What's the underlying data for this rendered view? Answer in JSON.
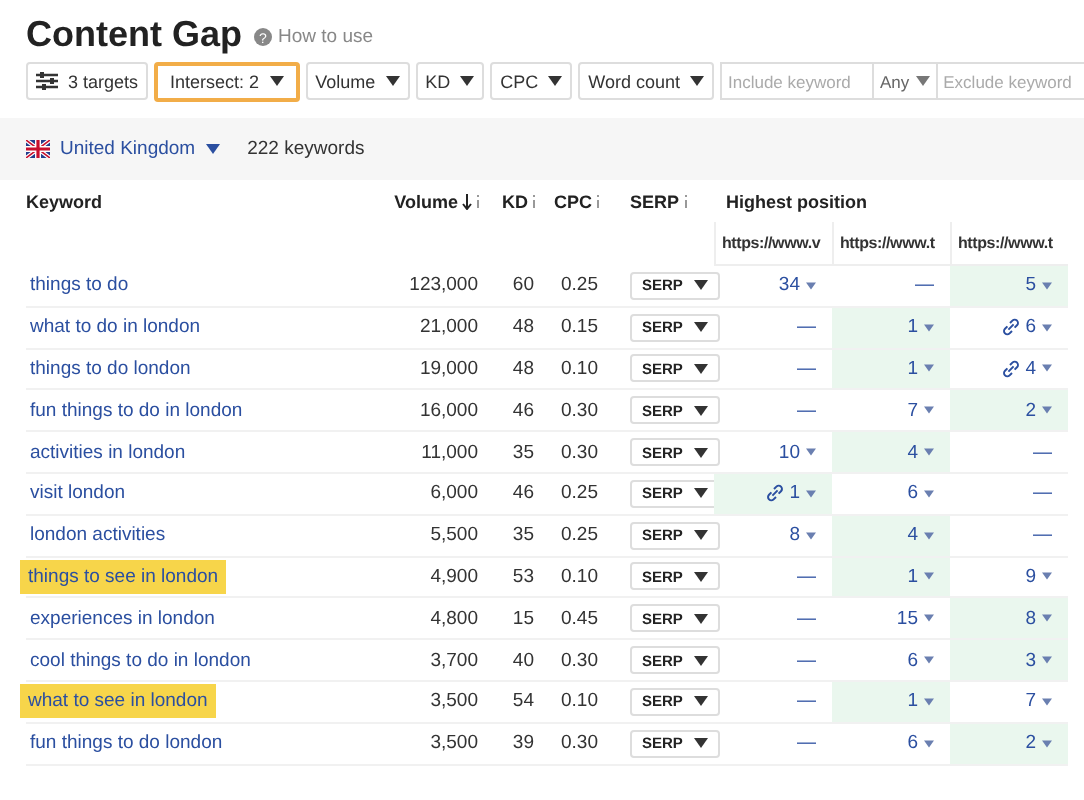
{
  "header": {
    "title": "Content Gap",
    "help_icon": "?",
    "help_link": "How to use"
  },
  "filters": [
    {
      "kind": "targets",
      "label": "3 targets",
      "highlighted": false
    },
    {
      "kind": "dropdown",
      "label": "Intersect: 2",
      "highlighted": true
    },
    {
      "kind": "dropdown",
      "label": "Volume",
      "highlighted": false
    },
    {
      "kind": "dropdown",
      "label": "KD",
      "highlighted": false
    },
    {
      "kind": "dropdown",
      "label": "CPC",
      "highlighted": false
    },
    {
      "kind": "dropdown",
      "label": "Word count",
      "highlighted": false
    }
  ],
  "include_field": {
    "placeholder": "Include keyword"
  },
  "match_dropdown": {
    "value": "Any"
  },
  "exclude_field": {
    "placeholder": "Exclude keyword"
  },
  "summary": {
    "country": "United Kingdom",
    "count": "222 keywords"
  },
  "table": {
    "columns": [
      "Keyword",
      "Volume",
      "KD",
      "CPC",
      "SERP",
      "Highest position"
    ],
    "targets": [
      "https://www.v",
      "https://www.t",
      "https://www.t"
    ],
    "rows": [
      {
        "keyword": "things to do",
        "highlighted": false,
        "volume": "123,000",
        "kd": "60",
        "cpc": "0.25",
        "serp": "SERP",
        "positions": [
          {
            "value": "34",
            "best": false,
            "link": false
          },
          {
            "value": "—",
            "best": false,
            "link": false
          },
          {
            "value": "5",
            "best": true,
            "link": false
          }
        ]
      },
      {
        "keyword": "what to do in london",
        "highlighted": false,
        "volume": "21,000",
        "kd": "48",
        "cpc": "0.15",
        "serp": "SERP",
        "positions": [
          {
            "value": "—",
            "best": false,
            "link": false
          },
          {
            "value": "1",
            "best": true,
            "link": false
          },
          {
            "value": "6",
            "best": false,
            "link": true
          }
        ]
      },
      {
        "keyword": "things to do london",
        "highlighted": false,
        "volume": "19,000",
        "kd": "48",
        "cpc": "0.10",
        "serp": "SERP",
        "positions": [
          {
            "value": "—",
            "best": false,
            "link": false
          },
          {
            "value": "1",
            "best": true,
            "link": false
          },
          {
            "value": "4",
            "best": false,
            "link": true
          }
        ]
      },
      {
        "keyword": "fun things to do in london",
        "highlighted": false,
        "volume": "16,000",
        "kd": "46",
        "cpc": "0.30",
        "serp": "SERP",
        "positions": [
          {
            "value": "—",
            "best": false,
            "link": false
          },
          {
            "value": "7",
            "best": false,
            "link": false
          },
          {
            "value": "2",
            "best": true,
            "link": false
          }
        ]
      },
      {
        "keyword": "activities in london",
        "highlighted": false,
        "volume": "11,000",
        "kd": "35",
        "cpc": "0.30",
        "serp": "SERP",
        "positions": [
          {
            "value": "10",
            "best": false,
            "link": false
          },
          {
            "value": "4",
            "best": true,
            "link": false
          },
          {
            "value": "—",
            "best": false,
            "link": false
          }
        ]
      },
      {
        "keyword": "visit london",
        "highlighted": false,
        "volume": "6,000",
        "kd": "46",
        "cpc": "0.25",
        "serp": "SERP",
        "positions": [
          {
            "value": "1",
            "best": true,
            "link": true
          },
          {
            "value": "6",
            "best": false,
            "link": false
          },
          {
            "value": "—",
            "best": false,
            "link": false
          }
        ]
      },
      {
        "keyword": "london activities",
        "highlighted": false,
        "volume": "5,500",
        "kd": "35",
        "cpc": "0.25",
        "serp": "SERP",
        "positions": [
          {
            "value": "8",
            "best": false,
            "link": false
          },
          {
            "value": "4",
            "best": true,
            "link": false
          },
          {
            "value": "—",
            "best": false,
            "link": false
          }
        ]
      },
      {
        "keyword": "things to see in london",
        "highlighted": true,
        "volume": "4,900",
        "kd": "53",
        "cpc": "0.10",
        "serp": "SERP",
        "positions": [
          {
            "value": "—",
            "best": false,
            "link": false
          },
          {
            "value": "1",
            "best": true,
            "link": false
          },
          {
            "value": "9",
            "best": false,
            "link": false
          }
        ]
      },
      {
        "keyword": "experiences in london",
        "highlighted": false,
        "volume": "4,800",
        "kd": "15",
        "cpc": "0.45",
        "serp": "SERP",
        "positions": [
          {
            "value": "—",
            "best": false,
            "link": false
          },
          {
            "value": "15",
            "best": false,
            "link": false
          },
          {
            "value": "8",
            "best": true,
            "link": false
          }
        ]
      },
      {
        "keyword": "cool things to do in london",
        "highlighted": false,
        "volume": "3,700",
        "kd": "40",
        "cpc": "0.30",
        "serp": "SERP",
        "positions": [
          {
            "value": "—",
            "best": false,
            "link": false
          },
          {
            "value": "6",
            "best": false,
            "link": false
          },
          {
            "value": "3",
            "best": true,
            "link": false
          }
        ]
      },
      {
        "keyword": "what to see in london",
        "highlighted": true,
        "volume": "3,500",
        "kd": "54",
        "cpc": "0.10",
        "serp": "SERP",
        "positions": [
          {
            "value": "—",
            "best": false,
            "link": false
          },
          {
            "value": "1",
            "best": true,
            "link": false
          },
          {
            "value": "7",
            "best": false,
            "link": false
          }
        ]
      },
      {
        "keyword": "fun things to do london",
        "highlighted": false,
        "volume": "3,500",
        "kd": "39",
        "cpc": "0.30",
        "serp": "SERP",
        "positions": [
          {
            "value": "—",
            "best": false,
            "link": false
          },
          {
            "value": "6",
            "best": false,
            "link": false
          },
          {
            "value": "2",
            "best": true,
            "link": false
          }
        ]
      }
    ]
  }
}
